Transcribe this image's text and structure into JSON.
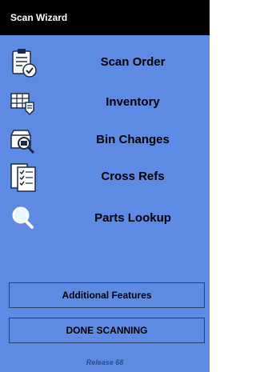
{
  "header": {
    "title": "Scan Wizard"
  },
  "menu": {
    "items": [
      {
        "label": "Scan Order",
        "icon": "clipboard-check-icon"
      },
      {
        "label": "Inventory",
        "icon": "inventory-boxes-icon"
      },
      {
        "label": "Bin Changes",
        "icon": "bin-search-icon"
      },
      {
        "label": "Cross Refs",
        "icon": "checklist-icon"
      },
      {
        "label": "Parts Lookup",
        "icon": "magnifier-icon"
      }
    ]
  },
  "buttons": {
    "additional_features": "Additional Features",
    "done_scanning": "DONE SCANNING"
  },
  "footer": {
    "release": "Release 68"
  },
  "colors": {
    "panel": "#5d8be3",
    "header": "#000000"
  }
}
